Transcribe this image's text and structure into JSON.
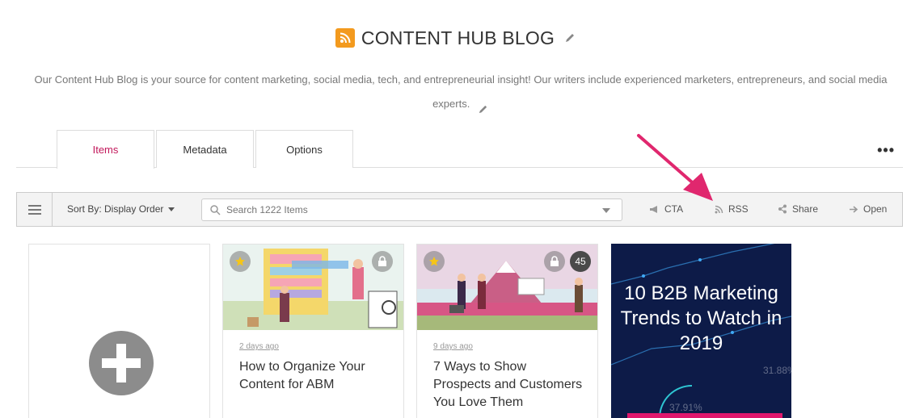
{
  "header": {
    "title": "CONTENT HUB BLOG",
    "description_line1": "Our Content Hub Blog is your source for content marketing, social media, tech, and entrepreneurial insight! Our writers include experienced marketers, entrepreneurs, and social media",
    "description_line2": "experts.",
    "accent_color": "#f39a1e"
  },
  "tabs": [
    {
      "label": "Items",
      "active": true
    },
    {
      "label": "Metadata",
      "active": false
    },
    {
      "label": "Options",
      "active": false
    }
  ],
  "more_label": "•••",
  "toolbar": {
    "sort_label": "Sort By: Display Order",
    "search_placeholder": "Search 1222 Items",
    "cta_label": "CTA",
    "rss_label": "RSS",
    "share_label": "Share",
    "open_label": "Open"
  },
  "annotation": {
    "color": "#e0276e",
    "points_to": "RSS"
  },
  "cards": [
    {
      "ago": "2 days ago",
      "title": "How to Organize Your Content for ABM"
    },
    {
      "ago": "9 days ago",
      "title": "7 Ways to Show Prospects and Customers You Love Them",
      "count": "45"
    },
    {
      "title": "10 B2B Marketing Trends to Watch in 2019",
      "stat1": "31.88%",
      "stat2": "37.91%"
    }
  ],
  "colors": {
    "active_tab": "#c2185b",
    "b2b_bg": "#0d1b48",
    "b2b_bar": "#e0176d"
  }
}
